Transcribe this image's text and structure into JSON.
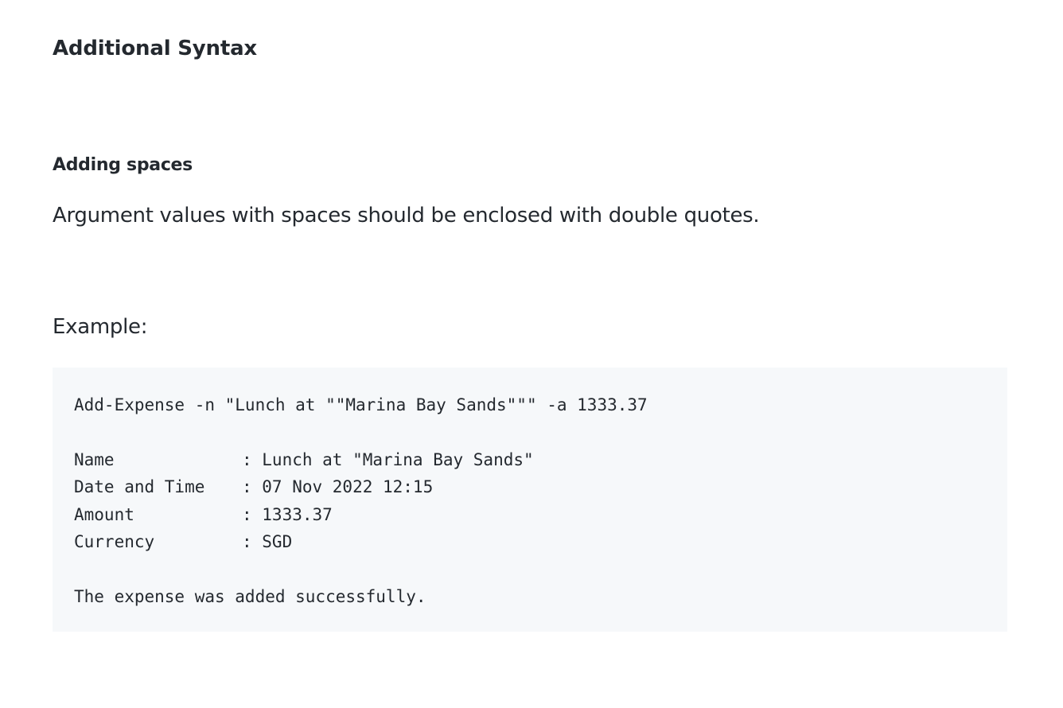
{
  "section": {
    "heading": "Additional Syntax",
    "subheading": "Adding spaces",
    "description": "Argument values with spaces should be enclosed with double quotes.",
    "example_label": "Example:"
  },
  "code": {
    "command": "Add-Expense -n \"Lunch at \"\"Marina Bay Sands\"\"\" -a 1333.37",
    "fields": [
      {
        "key": "Name",
        "value": ": Lunch at \"Marina Bay Sands\""
      },
      {
        "key": "Date and Time",
        "value": ": 07 Nov 2022 12:15"
      },
      {
        "key": "Amount",
        "value": ": 1333.37"
      },
      {
        "key": "Currency",
        "value": ": SGD"
      }
    ],
    "result": "The expense was added successfully."
  }
}
